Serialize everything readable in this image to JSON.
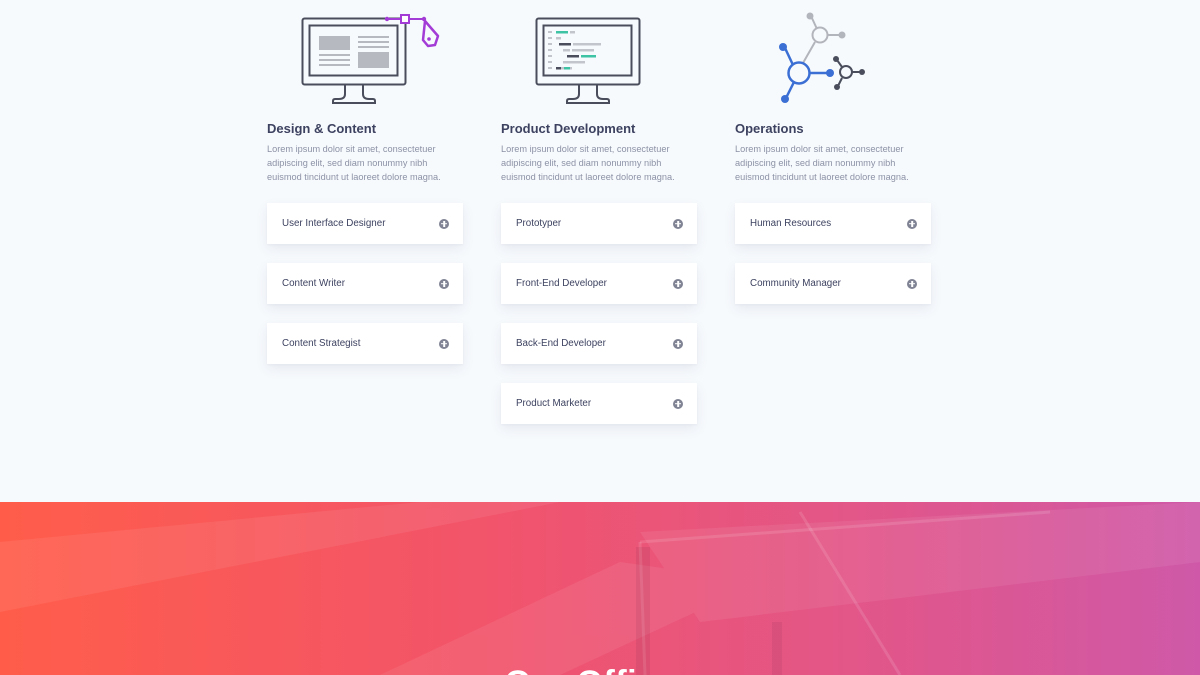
{
  "columns": [
    {
      "title": "Design & Content",
      "description": "Lorem ipsum dolor sit amet, consectetuer adipiscing elit, sed diam nonummy nibh euismod tincidunt ut laoreet dolore magna.",
      "icon": "monitor-design-icon",
      "jobs": [
        "User Interface Designer",
        "Content Writer",
        "Content Strategist"
      ]
    },
    {
      "title": "Product Development",
      "description": "Lorem ipsum dolor sit amet, consectetuer adipiscing elit, sed diam nonummy nibh euismod tincidunt ut laoreet dolore magna.",
      "icon": "monitor-code-icon",
      "jobs": [
        "Prototyper",
        "Front-End Developer",
        "Back-End Developer",
        "Product Marketer"
      ]
    },
    {
      "title": "Operations",
      "description": "Lorem ipsum dolor sit amet, consectetuer adipiscing elit, sed diam nonummy nibh euismod tincidunt ut laoreet dolore magna.",
      "icon": "network-icon",
      "jobs": [
        "Human Resources",
        "Community Manager"
      ]
    }
  ],
  "hero": {
    "title": "Our Offices"
  },
  "colors": {
    "page_background": "#f7fafd",
    "heading": "#3d4260",
    "body_text": "#8c92a6",
    "card_background": "#ffffff",
    "expand_icon": "#7f8393",
    "design_accent": "#a33bd6",
    "code_accent": "#3fc3a5",
    "network_blue": "#3b6fd4",
    "hero_gradient_start": "#ff5d4a",
    "hero_gradient_end": "#cf59a8"
  }
}
